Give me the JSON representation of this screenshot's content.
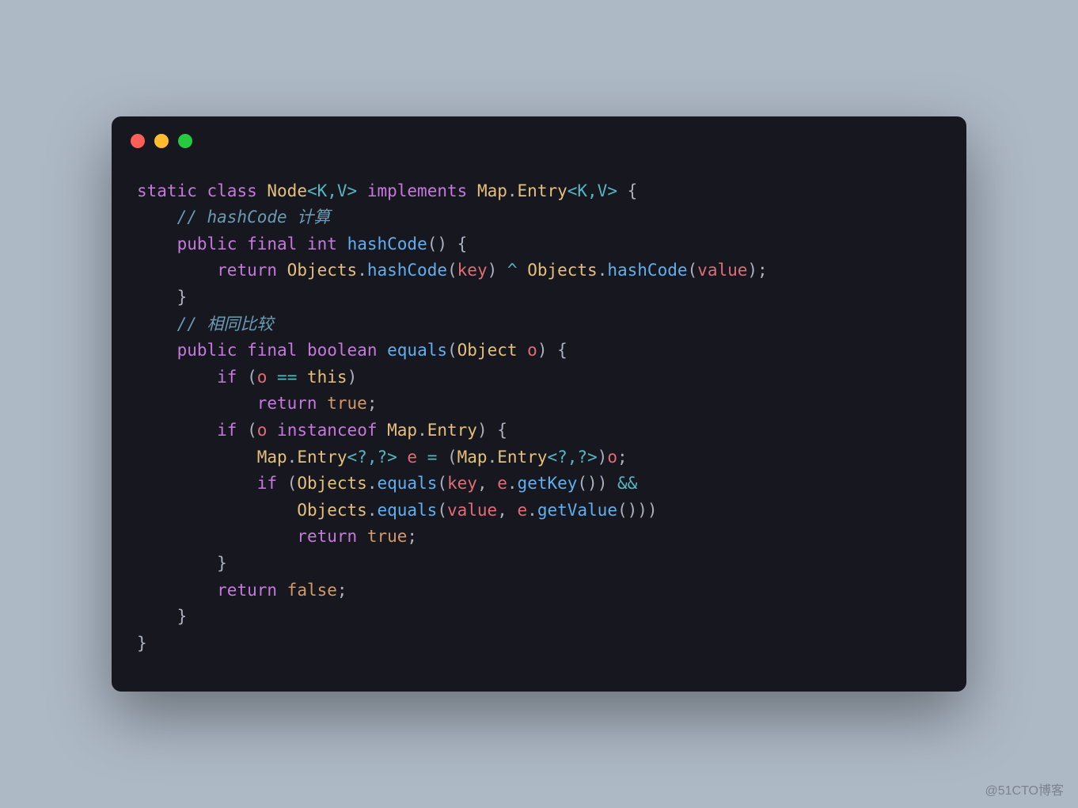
{
  "code": {
    "l1": {
      "static": "static",
      "class": "class",
      "node": "Node",
      "gen1": "<K,V>",
      "impl": "implements",
      "map": "Map",
      "dot": ".",
      "entry": "Entry",
      "gen2": "<K,V>",
      "brace": " {"
    },
    "l2": {
      "comment": "// hashCode 计算"
    },
    "l3": {
      "public": "public",
      "final": "final",
      "int": "int",
      "hashCode": "hashCode",
      "paren": "()",
      "brace": " {"
    },
    "l4": {
      "return": "return",
      "objects1": "Objects",
      "dot1": ".",
      "hc1": "hashCode",
      "op1": "(",
      "key": "key",
      "cp1": ")",
      "xor": " ^ ",
      "objects2": "Objects",
      "dot2": ".",
      "hc2": "hashCode",
      "op2": "(",
      "value": "value",
      "cp2": ")",
      "semi": ";"
    },
    "l5": {
      "brace": "}"
    },
    "l6": {
      "comment": "// 相同比较"
    },
    "l7": {
      "public": "public",
      "final": "final",
      "boolean": "boolean",
      "equals": "equals",
      "op": "(",
      "object": "Object",
      "o": " o",
      "cp": ")",
      "brace": " {"
    },
    "l8": {
      "if": "if",
      "op": " (",
      "o": "o",
      "eq": " == ",
      "this": "this",
      "cp": ")"
    },
    "l9": {
      "return": "return",
      "true": "true",
      "semi": ";"
    },
    "l10": {
      "if": "if",
      "op": " (",
      "o": "o",
      "inst": " instanceof ",
      "map": "Map",
      "dot": ".",
      "entry": "Entry",
      "cp": ")",
      "brace": " {"
    },
    "l11": {
      "map": "Map",
      "dot1": ".",
      "entry": "Entry",
      "gen": "<?,?>",
      "e": " e ",
      "eq": "=",
      "op": " (",
      "map2": "Map",
      "dot2": ".",
      "entry2": "Entry",
      "gen2": "<?,?>",
      "cp": ")",
      "o": "o",
      "semi": ";"
    },
    "l12": {
      "if": "if",
      "op": " (",
      "objects": "Objects",
      "dot": ".",
      "equals": "equals",
      "op2": "(",
      "key": "key",
      "comma": ", ",
      "e": "e",
      "dot2": ".",
      "getKey": "getKey",
      "paren": "()",
      "cp": ")",
      "and": " &&"
    },
    "l13": {
      "objects": "Objects",
      "dot": ".",
      "equals": "equals",
      "op": "(",
      "value": "value",
      "comma": ", ",
      "e": "e",
      "dot2": ".",
      "getValue": "getValue",
      "paren": "()",
      "cp": "))"
    },
    "l14": {
      "return": "return",
      "true": "true",
      "semi": ";"
    },
    "l15": {
      "brace": "}"
    },
    "l16": {
      "return": "return",
      "false": "false",
      "semi": ";"
    },
    "l17": {
      "brace": "}"
    },
    "l18": {
      "brace": "}"
    }
  },
  "watermark": "@51CTO博客"
}
